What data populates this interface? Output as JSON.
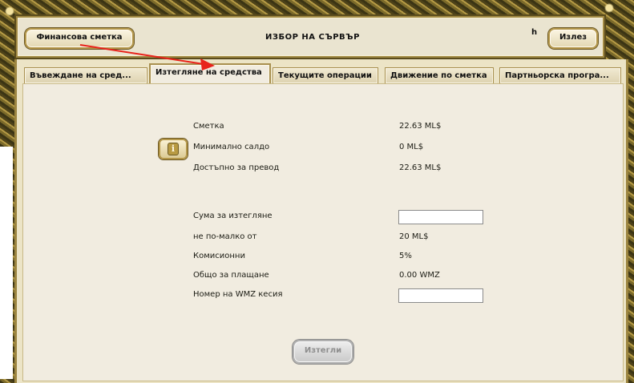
{
  "header": {
    "finance_button": "Финансова сметка",
    "title": "ИЗБОР НА СЪРВЪР",
    "h_label": "h",
    "exit_button": "Излез"
  },
  "tabs": [
    {
      "label": "Въвеждане на сред...",
      "active": false
    },
    {
      "label": "Изтегляне на средства",
      "active": true
    },
    {
      "label": "Текущите операции",
      "active": false
    },
    {
      "label": "Движение по сметка",
      "active": false
    },
    {
      "label": "Партньорска програ...",
      "active": false
    }
  ],
  "balance": {
    "account_label": "Сметка",
    "account_value": "22.63 ML$",
    "min_balance_label": "Минимално салдо",
    "min_balance_value": "0 ML$",
    "available_label": "Достъпно за превод",
    "available_value": "22.63 ML$"
  },
  "withdraw": {
    "amount_label": "Сума за изтегляне",
    "amount_value": "",
    "min_label": "не по-малко от",
    "min_value": "20 ML$",
    "commission_label": "Комисионни",
    "commission_value": "5%",
    "total_label": "Общо за плащане",
    "total_value": "0.00 WMZ",
    "purse_label": "Номер на WMZ кесия",
    "purse_value": "",
    "submit_button": "Изтегли"
  },
  "colors": {
    "annotation_arrow": "#e8231b",
    "gold_border": "#b4974a",
    "panel_bg": "#f1ece0"
  },
  "icons": {
    "info": "info-icon"
  }
}
